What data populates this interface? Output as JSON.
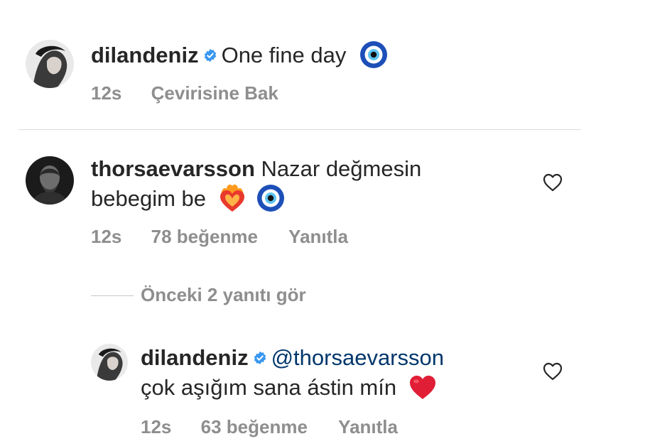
{
  "caption": {
    "username": "dilandeniz",
    "verified_icon": "verified-badge-icon",
    "text": "One fine day",
    "emoji": "nazar-amulet-icon",
    "time": "12s",
    "translate_label": "Çevirisine Bak"
  },
  "comment": {
    "username": "thorsaevarsson",
    "text_line1": "Nazar değmesin",
    "text_line2": "bebegim be",
    "emojis": [
      "heart-on-fire-icon",
      "nazar-amulet-icon"
    ],
    "time": "12s",
    "likes": "78 beğenme",
    "reply_label": "Yanıtla",
    "like_icon": "heart-outline-icon"
  },
  "view_replies_label": "Önceki 2 yanıtı gör",
  "reply": {
    "username": "dilandeniz",
    "verified_icon": "verified-badge-icon",
    "mention": "@thorsaevarsson",
    "text": "çok aşığım sana ástin mín",
    "emoji": "red-heart-icon",
    "time": "12s",
    "likes": "63 beğenme",
    "reply_label": "Yanıtla",
    "like_icon": "heart-outline-icon"
  },
  "colors": {
    "text": "#262626",
    "meta": "#8e8e8e",
    "verified": "#3897f0",
    "mention": "#00376b",
    "heart": "#e0245e"
  }
}
